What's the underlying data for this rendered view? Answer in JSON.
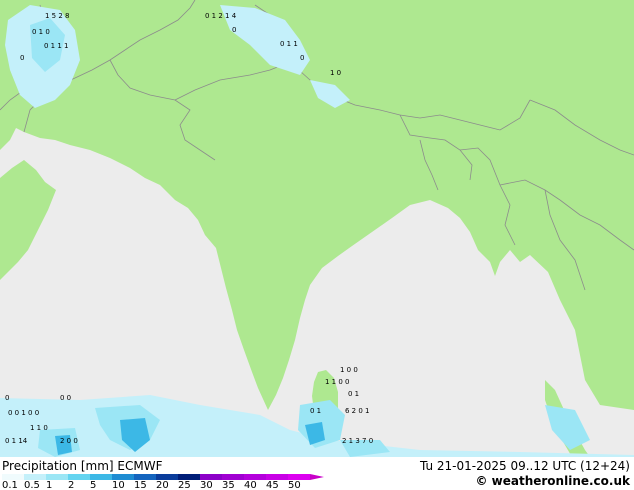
{
  "map": {
    "title": "Precipitation [mm]",
    "model": "ECMWF",
    "datetime": "Tu 21-01-2025 09..12 UTC (12+24)",
    "credit": "© weatheronline.co.uk",
    "colors": {
      "land": "#aee890",
      "sea": "#ececec",
      "border": "#8c8c8c",
      "light_precip": "#9be6f5",
      "mid_precip": "#3cc8f0"
    },
    "grid_values": [
      {
        "v": "1 5  2  8",
        "region": "nw"
      },
      {
        "v": "0 1 2 1 4",
        "region": "n"
      },
      {
        "v": "0",
        "region": "n"
      },
      {
        "v": "0 1 0",
        "region": "nw"
      },
      {
        "v": "0 1 1",
        "region": "n"
      },
      {
        "v": "0",
        "region": "n"
      },
      {
        "v": "0 1 1 1",
        "region": "nw"
      },
      {
        "v": "0",
        "region": "nw"
      },
      {
        "v": "1 0",
        "region": "n"
      },
      {
        "v": "0",
        "region": "sw"
      },
      {
        "v": "0 0",
        "region": "sw"
      },
      {
        "v": "0 0 1 0 0",
        "region": "sw"
      },
      {
        "v": "1 0 0",
        "region": "se"
      },
      {
        "v": "1 1 0 0",
        "region": "se"
      },
      {
        "v": "0 1",
        "region": "se"
      },
      {
        "v": "1 1 0",
        "region": "sw"
      },
      {
        "v": "0 1",
        "region": "se"
      },
      {
        "v": "2 0 0",
        "region": "sw"
      },
      {
        "v": "6 2 0 1",
        "region": "se"
      },
      {
        "v": "0 1 14",
        "region": "sw"
      },
      {
        "v": "2 1 3 7 0",
        "region": "se"
      }
    ]
  },
  "legend": {
    "swatches": [
      {
        "value": "0.1",
        "color": "#f0fbfd"
      },
      {
        "value": "0.5",
        "color": "#c4f0fa"
      },
      {
        "value": "1",
        "color": "#9be6f5"
      },
      {
        "value": "2",
        "color": "#64d4f0"
      },
      {
        "value": "5",
        "color": "#3cb8e6"
      },
      {
        "value": "10",
        "color": "#1e8cd2"
      },
      {
        "value": "15",
        "color": "#1464be"
      },
      {
        "value": "20",
        "color": "#0a3c9b"
      },
      {
        "value": "25",
        "color": "#001e78"
      },
      {
        "value": "30",
        "color": "#8c00c8"
      },
      {
        "value": "35",
        "color": "#a000d2"
      },
      {
        "value": "40",
        "color": "#b400dc"
      },
      {
        "value": "45",
        "color": "#c800e6"
      },
      {
        "value": "50",
        "color": "#dc00f0"
      }
    ]
  }
}
